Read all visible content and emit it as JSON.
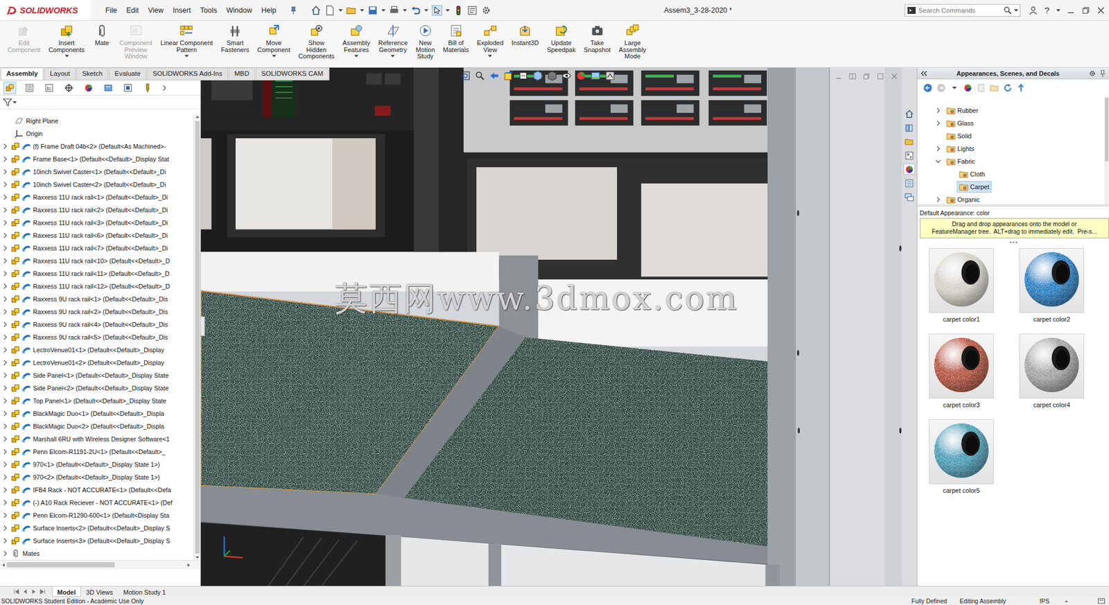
{
  "app": {
    "logo": "SOLIDWORKS",
    "title": "Assem3_3-28-2020 *",
    "search_placeholder": "Search Commands",
    "help": "?"
  },
  "menu": [
    "File",
    "Edit",
    "View",
    "Insert",
    "Tools",
    "Window",
    "Help"
  ],
  "ribbon": [
    {
      "label": "Edit\nComponent",
      "disabled": true,
      "dropdown": false
    },
    {
      "label": "Insert\nComponents",
      "disabled": false,
      "dropdown": true
    },
    {
      "label": "Mate",
      "disabled": false,
      "dropdown": false
    },
    {
      "label": "Component\nPreview\nWindow",
      "disabled": true,
      "dropdown": false
    },
    {
      "label": "Linear Component\nPattern",
      "disabled": false,
      "dropdown": true
    },
    {
      "label": "Smart\nFasteners",
      "disabled": false,
      "dropdown": false
    },
    {
      "label": "Move\nComponent",
      "disabled": false,
      "dropdown": true
    },
    {
      "label": "Show\nHidden\nComponents",
      "disabled": false,
      "dropdown": false
    },
    {
      "label": "Assembly\nFeatures",
      "disabled": false,
      "dropdown": true
    },
    {
      "label": "Reference\nGeometry",
      "disabled": false,
      "dropdown": true
    },
    {
      "label": "New\nMotion\nStudy",
      "disabled": false,
      "dropdown": false
    },
    {
      "label": "Bill of\nMaterials",
      "disabled": false,
      "dropdown": false
    },
    {
      "label": "Exploded\nView",
      "disabled": false,
      "dropdown": true
    },
    {
      "label": "Instant3D",
      "disabled": false,
      "dropdown": false
    },
    {
      "label": "Update\nSpeedpak",
      "disabled": false,
      "dropdown": false
    },
    {
      "label": "Take\nSnapshot",
      "disabled": false,
      "dropdown": false
    },
    {
      "label": "Large\nAssembly\nMode",
      "disabled": false,
      "dropdown": false
    }
  ],
  "command_tabs": [
    {
      "label": "Assembly",
      "selected": true
    },
    {
      "label": "Layout",
      "selected": false
    },
    {
      "label": "Sketch",
      "selected": false
    },
    {
      "label": "Evaluate",
      "selected": false
    },
    {
      "label": "SOLIDWORKS Add-Ins",
      "selected": false
    },
    {
      "label": "MBD",
      "selected": false
    },
    {
      "label": "SOLIDWORKS CAM",
      "selected": false
    }
  ],
  "feature_manager": {
    "panel_tabs": [
      {
        "selected": true
      },
      {
        "selected": false
      },
      {
        "selected": false
      },
      {
        "selected": false
      },
      {
        "selected": false
      },
      {
        "selected": false
      },
      {
        "selected": false
      },
      {
        "selected": false
      }
    ],
    "tree": [
      {
        "label": "Right Plane",
        "kind": "plane",
        "expanded": false
      },
      {
        "label": "Origin",
        "kind": "origin",
        "expanded": false
      },
      {
        "label": "(f) Frame Draft 04b<2> (Default<As Machined>-",
        "kind": "component",
        "expanded": false
      },
      {
        "label": "Frame Base<1> (Default<<Default>_Display Stat",
        "kind": "component",
        "expanded": false
      },
      {
        "label": "10inch Swivel Caster<1> (Default<<Default>_Di",
        "kind": "component",
        "expanded": false
      },
      {
        "label": "10inch Swivel Caster<2> (Default<<Default>_Di",
        "kind": "component",
        "expanded": false
      },
      {
        "label": "Raxxess 11U rack rail<1> (Default<<Default>_Di",
        "kind": "component",
        "expanded": false
      },
      {
        "label": "Raxxess 11U rack rail<2> (Default<<Default>_Di",
        "kind": "component",
        "expanded": false
      },
      {
        "label": "Raxxess 11U rack rail<3> (Default<<Default>_Di",
        "kind": "component",
        "expanded": false
      },
      {
        "label": "Raxxess 11U rack rail<6> (Default<<Default>_Di",
        "kind": "component",
        "expanded": false
      },
      {
        "label": "Raxxess 11U rack rail<7> (Default<<Default>_Di",
        "kind": "component",
        "expanded": false
      },
      {
        "label": "Raxxess 11U rack rail<10> (Default<<Default>_D",
        "kind": "component",
        "expanded": false
      },
      {
        "label": "Raxxess 11U rack rail<11> (Default<<Default>_D",
        "kind": "component",
        "expanded": false
      },
      {
        "label": "Raxxess 11U rack rail<12> (Default<<Default>_D",
        "kind": "component",
        "expanded": false
      },
      {
        "label": "Raxxess 9U rack rail<1> (Default<<Default>_Dis",
        "kind": "component",
        "expanded": false
      },
      {
        "label": "Raxxess 9U rack rail<2> (Default<<Default>_Dis",
        "kind": "component",
        "expanded": false
      },
      {
        "label": "Raxxess 9U rack rail<4> (Default<<Default>_Dis",
        "kind": "component",
        "expanded": false
      },
      {
        "label": "Raxxess 9U rack rail<5> (Default<<Default>_Dis",
        "kind": "component",
        "expanded": false
      },
      {
        "label": "LectroVenue01<1> (Default<<Default>_Display",
        "kind": "component",
        "expanded": false
      },
      {
        "label": "LectroVenue01<2> (Default<<Default>_Display",
        "kind": "component",
        "expanded": false
      },
      {
        "label": "Side Panel<1> (Default<<Default>_Display State",
        "kind": "component",
        "expanded": false
      },
      {
        "label": "Side Panel<2> (Default<<Default>_Display State",
        "kind": "component",
        "expanded": false
      },
      {
        "label": "Top Panel<1> (Default<<Default>_Display State",
        "kind": "component",
        "expanded": false
      },
      {
        "label": "BlackMagic Duo<1> (Default<<Default>_Displa",
        "kind": "component",
        "expanded": false
      },
      {
        "label": "BlackMagic Duo<2> (Default<<Default>_Displa",
        "kind": "component",
        "expanded": false
      },
      {
        "label": "Marshall 6RU with Wireless Designer Software<1",
        "kind": "component",
        "expanded": false
      },
      {
        "label": "Penn Elcom-R1191-2U<1> (Default<<Default>_",
        "kind": "component",
        "expanded": false
      },
      {
        "label": "970<1> (Default<<Default>_Display State 1>)",
        "kind": "component",
        "expanded": false
      },
      {
        "label": "970<2> (Default<<Default>_Display State 1>)",
        "kind": "component",
        "expanded": false
      },
      {
        "label": "IFB4 Rack - NOT ACCURATE<1> (Default<<Defa",
        "kind": "component",
        "expanded": false
      },
      {
        "label": "(-) A10 Rack Reciever - NOT ACCURATE<1> (Def",
        "kind": "component",
        "expanded": false
      },
      {
        "label": "Penn Elcom-R1290-600<1> (Default<Display Sta",
        "kind": "component",
        "expanded": false
      },
      {
        "label": "Surface Inserts<2> (Default<<Default>_Display S",
        "kind": "component",
        "expanded": false
      },
      {
        "label": "Surface Inserts<3> (Default<<Default>_Display S",
        "kind": "component",
        "expanded": false
      },
      {
        "label": "Mates",
        "kind": "mates",
        "expanded": false
      }
    ]
  },
  "viewport": {
    "watermark": "莫西网www.3dmox.com"
  },
  "task_tabs": [
    {
      "selected": false
    },
    {
      "selected": false
    },
    {
      "selected": false
    },
    {
      "selected": false
    },
    {
      "selected": true
    },
    {
      "selected": false
    },
    {
      "selected": false
    }
  ],
  "task_pane": {
    "title": "Appearances, Scenes, and Decals",
    "tree": [
      {
        "label": "Rubber",
        "expandable": true,
        "expanded": false,
        "selected": false,
        "children": []
      },
      {
        "label": "Glass",
        "expandable": true,
        "expanded": false,
        "selected": false,
        "children": []
      },
      {
        "label": "Solid",
        "expandable": false,
        "expanded": false,
        "selected": false,
        "children": []
      },
      {
        "label": "Lights",
        "expandable": true,
        "expanded": false,
        "selected": false,
        "children": []
      },
      {
        "label": "Fabric",
        "expandable": true,
        "expanded": true,
        "selected": false,
        "children": [
          {
            "label": "Cloth",
            "expandable": false,
            "expanded": false,
            "selected": false,
            "children": []
          },
          {
            "label": "Carpet",
            "expandable": false,
            "expanded": false,
            "selected": true,
            "children": []
          }
        ]
      },
      {
        "label": "Organic",
        "expandable": true,
        "expanded": false,
        "selected": false,
        "children": []
      }
    ],
    "default_appearance": "Default Appearance: color",
    "tip": "Drag and drop appearances onto the model or\nFeatureManager tree.  ALT+drag to immediately edit.  Pre-s...",
    "swatches": [
      {
        "label": "carpet color1",
        "color": "#d3cfc6",
        "selected": false
      },
      {
        "label": "carpet color2",
        "color": "#2a7dc0",
        "selected": false
      },
      {
        "label": "carpet color3",
        "color": "#b4533f",
        "selected": false
      },
      {
        "label": "carpet color4",
        "color": "#a3a3a3",
        "selected": false
      },
      {
        "label": "carpet color5",
        "color": "#4c9db6",
        "selected": false
      }
    ]
  },
  "bottom_tabs": [
    {
      "label": "Model",
      "selected": true
    },
    {
      "label": "3D Views",
      "selected": false
    },
    {
      "label": "Motion Study 1",
      "selected": false
    }
  ],
  "status_bar": {
    "edition": "SOLIDWORKS Student Edition - Academic Use Only",
    "state": "Fully Defined",
    "mode": "Editing Assembly",
    "units": "IPS"
  }
}
